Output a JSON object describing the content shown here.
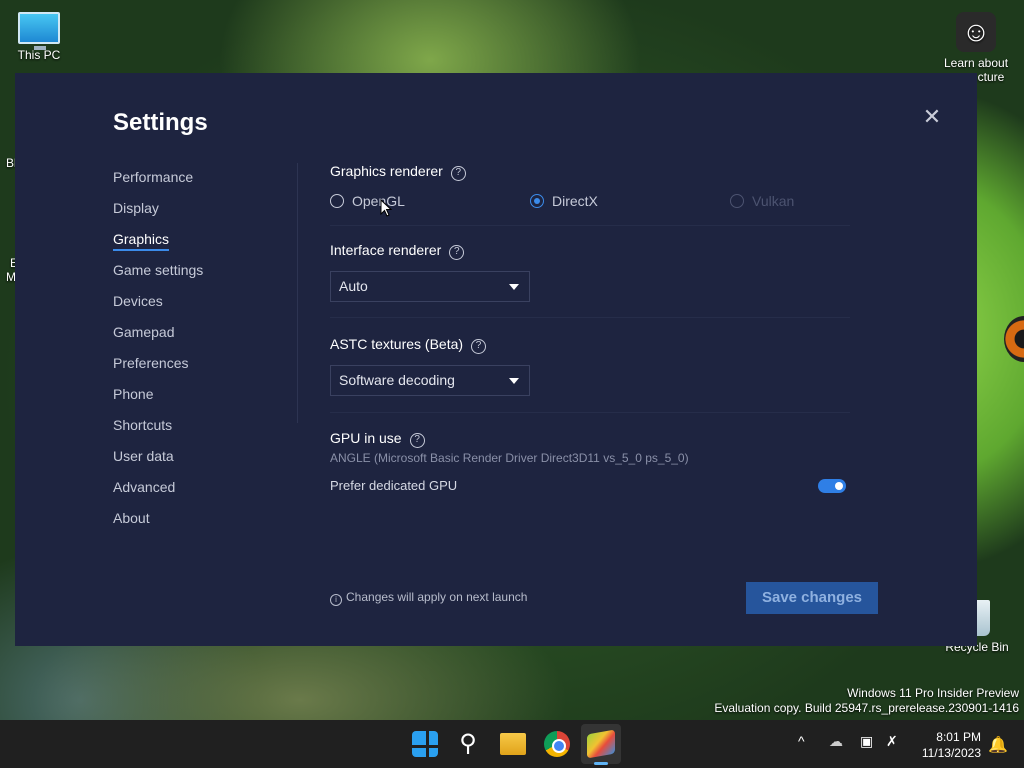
{
  "desktop": {
    "icons": {
      "this_pc": "This PC",
      "learn_about_line1": "Learn about",
      "learn_about_line2": "cture",
      "recycle_bin": "Recycle Bin"
    },
    "edge_fragments": {
      "left_top": "Bl",
      "left_mid1": "E",
      "left_mid2": "M"
    },
    "watermark": {
      "line1": "Windows 11 Pro Insider Preview",
      "line2": "Evaluation copy. Build 25947.rs_prerelease.230901-1416"
    }
  },
  "settings": {
    "title": "Settings",
    "nav": [
      {
        "label": "Performance"
      },
      {
        "label": "Display"
      },
      {
        "label": "Graphics",
        "active": true
      },
      {
        "label": "Game settings"
      },
      {
        "label": "Devices"
      },
      {
        "label": "Gamepad"
      },
      {
        "label": "Preferences"
      },
      {
        "label": "Phone"
      },
      {
        "label": "Shortcuts"
      },
      {
        "label": "User data"
      },
      {
        "label": "Advanced"
      },
      {
        "label": "About"
      }
    ],
    "graphics_renderer": {
      "title": "Graphics renderer",
      "options": [
        "OpenGL",
        "DirectX",
        "Vulkan"
      ],
      "selected": "DirectX",
      "disabled": "Vulkan"
    },
    "interface_renderer": {
      "title": "Interface renderer",
      "value": "Auto"
    },
    "astc_textures": {
      "title": "ASTC textures (Beta)",
      "value": "Software decoding"
    },
    "gpu": {
      "title": "GPU in use",
      "value": "ANGLE (Microsoft Basic Render Driver Direct3D11 vs_5_0 ps_5_0)",
      "prefer_label": "Prefer dedicated GPU",
      "prefer_enabled": true
    },
    "footer": {
      "note": "Changes will apply on next launch",
      "save_label": "Save changes"
    },
    "accent_color": "#3b8bea"
  },
  "taskbar": {
    "clock": {
      "time": "8:01 PM",
      "date": "11/13/2023"
    },
    "apps": [
      "start-icon",
      "search-icon",
      "file-explorer-icon",
      "chrome-icon",
      "bluestacks-icon"
    ]
  }
}
